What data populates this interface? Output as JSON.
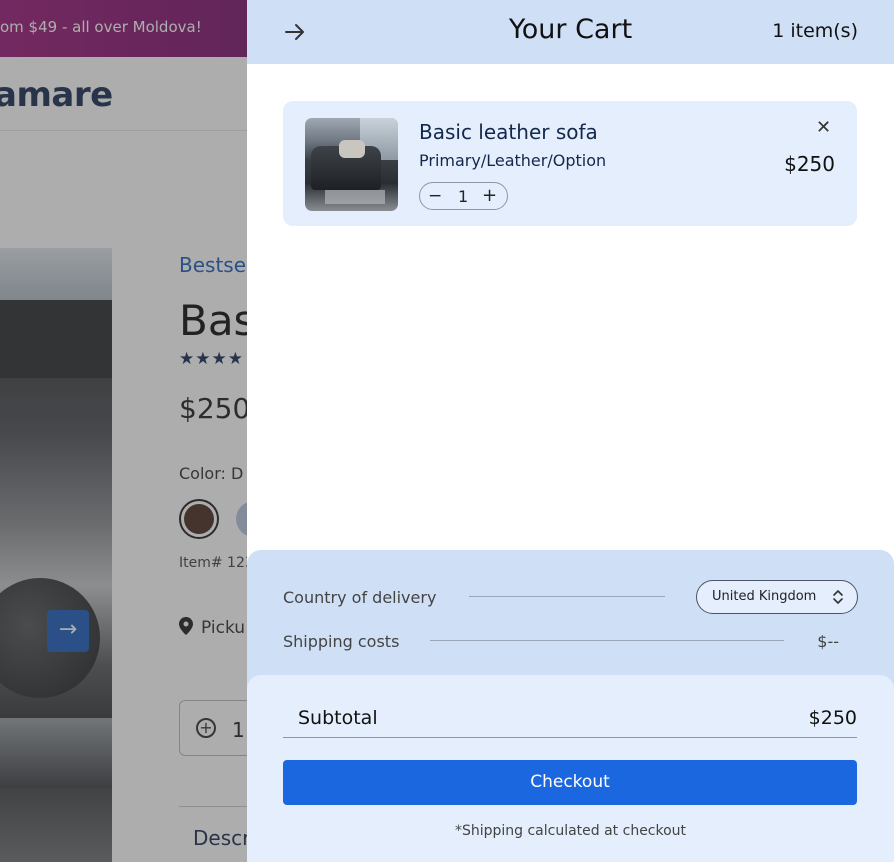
{
  "background_page": {
    "promo_text": "om $49 - all over Moldova!",
    "brand": "amare",
    "bestseller": "Bestsel",
    "title": "Bas",
    "stars": "★★★★",
    "price": "$250",
    "color_label": "Color:  D",
    "item_number": "Item# 123",
    "pickup": "Picku",
    "quantity": "1",
    "description_tab": "Descr",
    "photo_next_arrow": "→"
  },
  "cart": {
    "title": "Your Cart",
    "item_count": "1 item(s)",
    "items": [
      {
        "name": "Basic leather sofa",
        "variant": "Primary/Leather/Option",
        "quantity": "1",
        "price": "$250",
        "minus": "−",
        "plus": "+",
        "remove": "✕"
      }
    ]
  },
  "summary": {
    "delivery_label": "Country of delivery",
    "country": "United Kingdom",
    "shipping_label": "Shipping costs",
    "shipping_value": "$--",
    "subtotal_label": "Subtotal",
    "subtotal_value": "$250",
    "checkout_label": "Checkout",
    "note": "*Shipping calculated at checkout"
  },
  "colors": {
    "accent": "#1a67e0",
    "drawer_header": "#cfdff6",
    "item_card": "#e4eefc",
    "brand_navy": "#13284b"
  },
  "icons": {
    "back": "arrow-right-icon",
    "close": "close-icon",
    "select": "chevron-updown-icon",
    "pin": "location-pin-icon"
  }
}
